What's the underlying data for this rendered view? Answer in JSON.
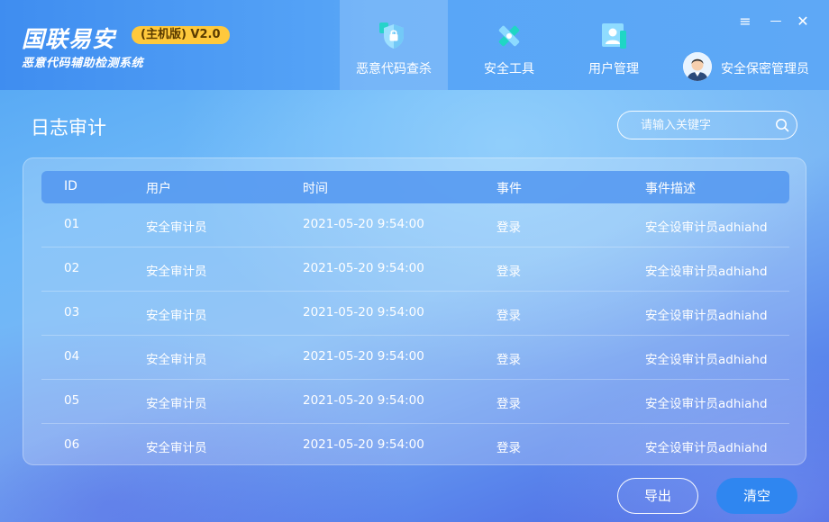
{
  "app": {
    "title": "国联易安",
    "edition": "(主机版) V2.0",
    "subtitle": "恶意代码辅助检测系统"
  },
  "nav": {
    "tabs": [
      {
        "label": "恶意代码查杀",
        "icon": "shield-lock-icon",
        "active": true
      },
      {
        "label": "安全工具",
        "icon": "tools-icon",
        "active": false
      },
      {
        "label": "用户管理",
        "icon": "user-card-icon",
        "active": false
      }
    ]
  },
  "user": {
    "name": "安全保密管理员",
    "icon": "avatar-icon"
  },
  "window_controls": {
    "menu": "≡",
    "minimize": "—",
    "close": "✕"
  },
  "page": {
    "title": "日志审计"
  },
  "search": {
    "placeholder": "请输入关键字"
  },
  "table": {
    "columns": {
      "id": "ID",
      "user": "用户",
      "time": "时间",
      "event": "事件",
      "description": "事件描述"
    },
    "rows": [
      {
        "id": "01",
        "user": "安全审计员",
        "time": "2021-05-20 9:54:00",
        "event": "登录",
        "description": "安全设审计员adhiahd"
      },
      {
        "id": "02",
        "user": "安全审计员",
        "time": "2021-05-20 9:54:00",
        "event": "登录",
        "description": "安全设审计员adhiahd"
      },
      {
        "id": "03",
        "user": "安全审计员",
        "time": "2021-05-20 9:54:00",
        "event": "登录",
        "description": "安全设审计员adhiahd"
      },
      {
        "id": "04",
        "user": "安全审计员",
        "time": "2021-05-20 9:54:00",
        "event": "登录",
        "description": "安全设审计员adhiahd"
      },
      {
        "id": "05",
        "user": "安全审计员",
        "time": "2021-05-20 9:54:00",
        "event": "登录",
        "description": "安全设审计员adhiahd"
      },
      {
        "id": "06",
        "user": "安全审计员",
        "time": "2021-05-20 9:54:00",
        "event": "登录",
        "description": "安全设审计员adhiahd"
      }
    ]
  },
  "actions": {
    "export": "导出",
    "clear": "清空"
  },
  "colors": {
    "accent": "#2f86f0",
    "badge": "#ffc93c",
    "header": "#4d9cf4"
  }
}
